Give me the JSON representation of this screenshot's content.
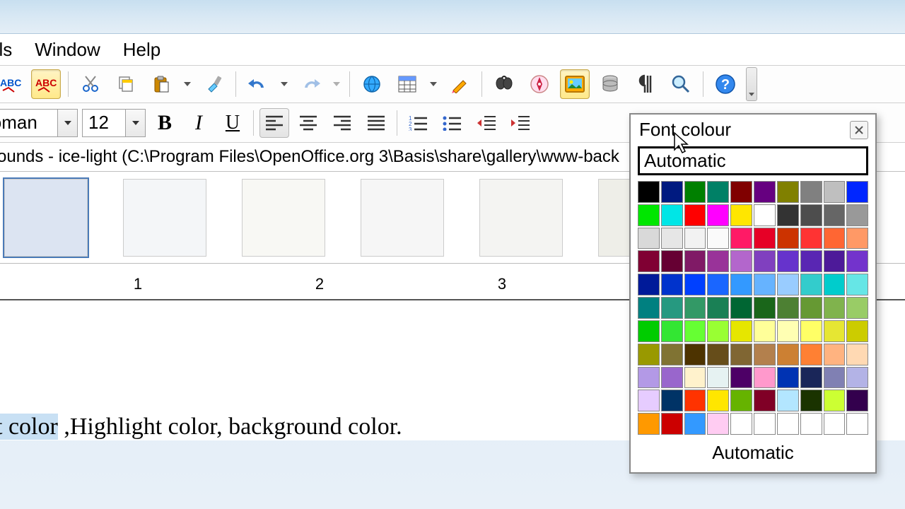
{
  "menubar": {
    "tools": "ols",
    "window": "Window",
    "help": "Help"
  },
  "font_name": "Roman",
  "font_size": "12",
  "gallery_path": "ounds - ice-light (C:\\Program Files\\OpenOffice.org 3\\Basis\\share\\gallery\\www-back",
  "ruler": {
    "n1": "1",
    "n2": "2",
    "n3": "3"
  },
  "doc_text": {
    "selected": "t color",
    "rest": " ,Highlight color, background color."
  },
  "popup": {
    "title": "Font colour",
    "auto_top": "Automatic",
    "auto_bottom": "Automatic",
    "swatches": [
      "#000000",
      "#001a80",
      "#008000",
      "#008066",
      "#800000",
      "#660080",
      "#808000",
      "#808080",
      "#bfbfbf",
      "#0026ff",
      "#00e600",
      "#00e6e6",
      "#ff0000",
      "#ff00ff",
      "#ffe600",
      "#ffffff",
      "#333333",
      "#4d4d4d",
      "#666666",
      "#999999",
      "#d9d9d9",
      "#e6e6e6",
      "#f2f2f2",
      "#fafafa",
      "#ff1a66",
      "#e60026",
      "#cc3300",
      "#ff3333",
      "#ff6633",
      "#ff9966",
      "#800033",
      "#660033",
      "#801a66",
      "#993399",
      "#b366cc",
      "#8040bf",
      "#6633cc",
      "#5926b3",
      "#4d1a99",
      "#7333cc",
      "#001a99",
      "#0033cc",
      "#0040ff",
      "#1a66ff",
      "#3399ff",
      "#66b3ff",
      "#99ccff",
      "#33cccc",
      "#00cccc",
      "#66e6e6",
      "#008080",
      "#269980",
      "#339966",
      "#1a8055",
      "#006633",
      "#1a661a",
      "#4d8033",
      "#669933",
      "#80b34d",
      "#99cc66",
      "#00cc00",
      "#33e633",
      "#66ff33",
      "#99ff33",
      "#e6e600",
      "#ffff99",
      "#ffffb3",
      "#ffff66",
      "#e6e633",
      "#cccc00",
      "#999900",
      "#807333",
      "#4d3300",
      "#664d1a",
      "#806633",
      "#b3804d",
      "#cc8033",
      "#ff8033",
      "#ffb380",
      "#ffd9b3",
      "#b399e6",
      "#9966cc",
      "#fff2cc",
      "#e6f2f2",
      "#4d0066",
      "#ff99cc",
      "#0033b3",
      "#1a2659",
      "#8080b3",
      "#b3b3e6",
      "#e6ccff",
      "#003366",
      "#ff3300",
      "#ffe600",
      "#66b300",
      "#800026",
      "#b3e6ff",
      "#1a3300",
      "#ccff33",
      "#33004d",
      "#ff9900",
      "#cc0000",
      "#3399ff",
      "#ffccf2",
      "#ffffff",
      "#ffffff",
      "#ffffff",
      "#ffffff",
      "#ffffff",
      "#ffffff"
    ]
  }
}
